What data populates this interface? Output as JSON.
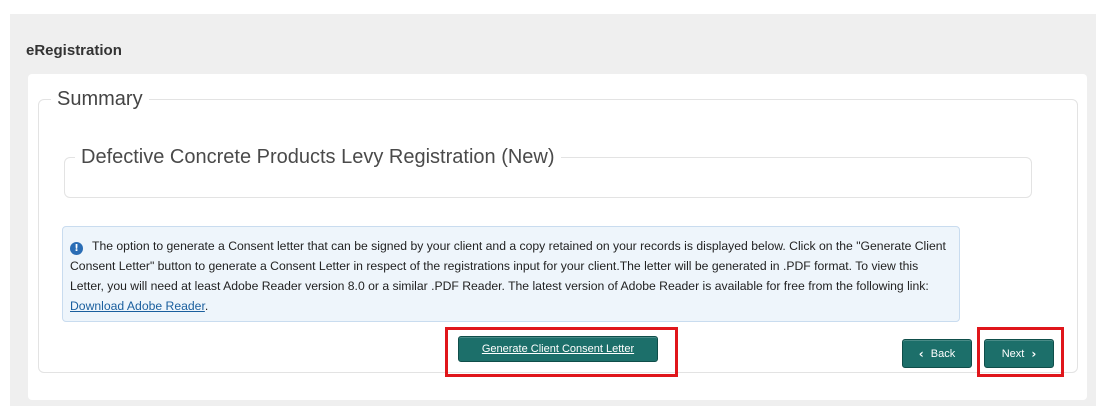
{
  "app": {
    "title": "eRegistration"
  },
  "summary": {
    "legend": "Summary",
    "registration_legend": "Defective Concrete Products Levy Registration (New)"
  },
  "info": {
    "icon": "info-circle-icon",
    "text": "The option to generate a Consent letter that can be signed by your client and a copy retained on your records is displayed below. Click on the \"Generate Client Consent Letter\" button to generate a Consent Letter in respect of the registrations input for your client.The letter will be generated in .PDF format. To view this Letter, you will need at least Adobe Reader version 8.0 or a similar .PDF Reader. The latest version of Adobe Reader is available for free from the following link: ",
    "link_text": "Download Adobe Reader",
    "trailing": "."
  },
  "buttons": {
    "consent_label": "Generate Client Consent Letter",
    "back_label": "Back",
    "next_label": "Next"
  },
  "colors": {
    "button": "#1c6f6a",
    "highlight": "#e0161b",
    "info_bg": "#eef5fb"
  }
}
